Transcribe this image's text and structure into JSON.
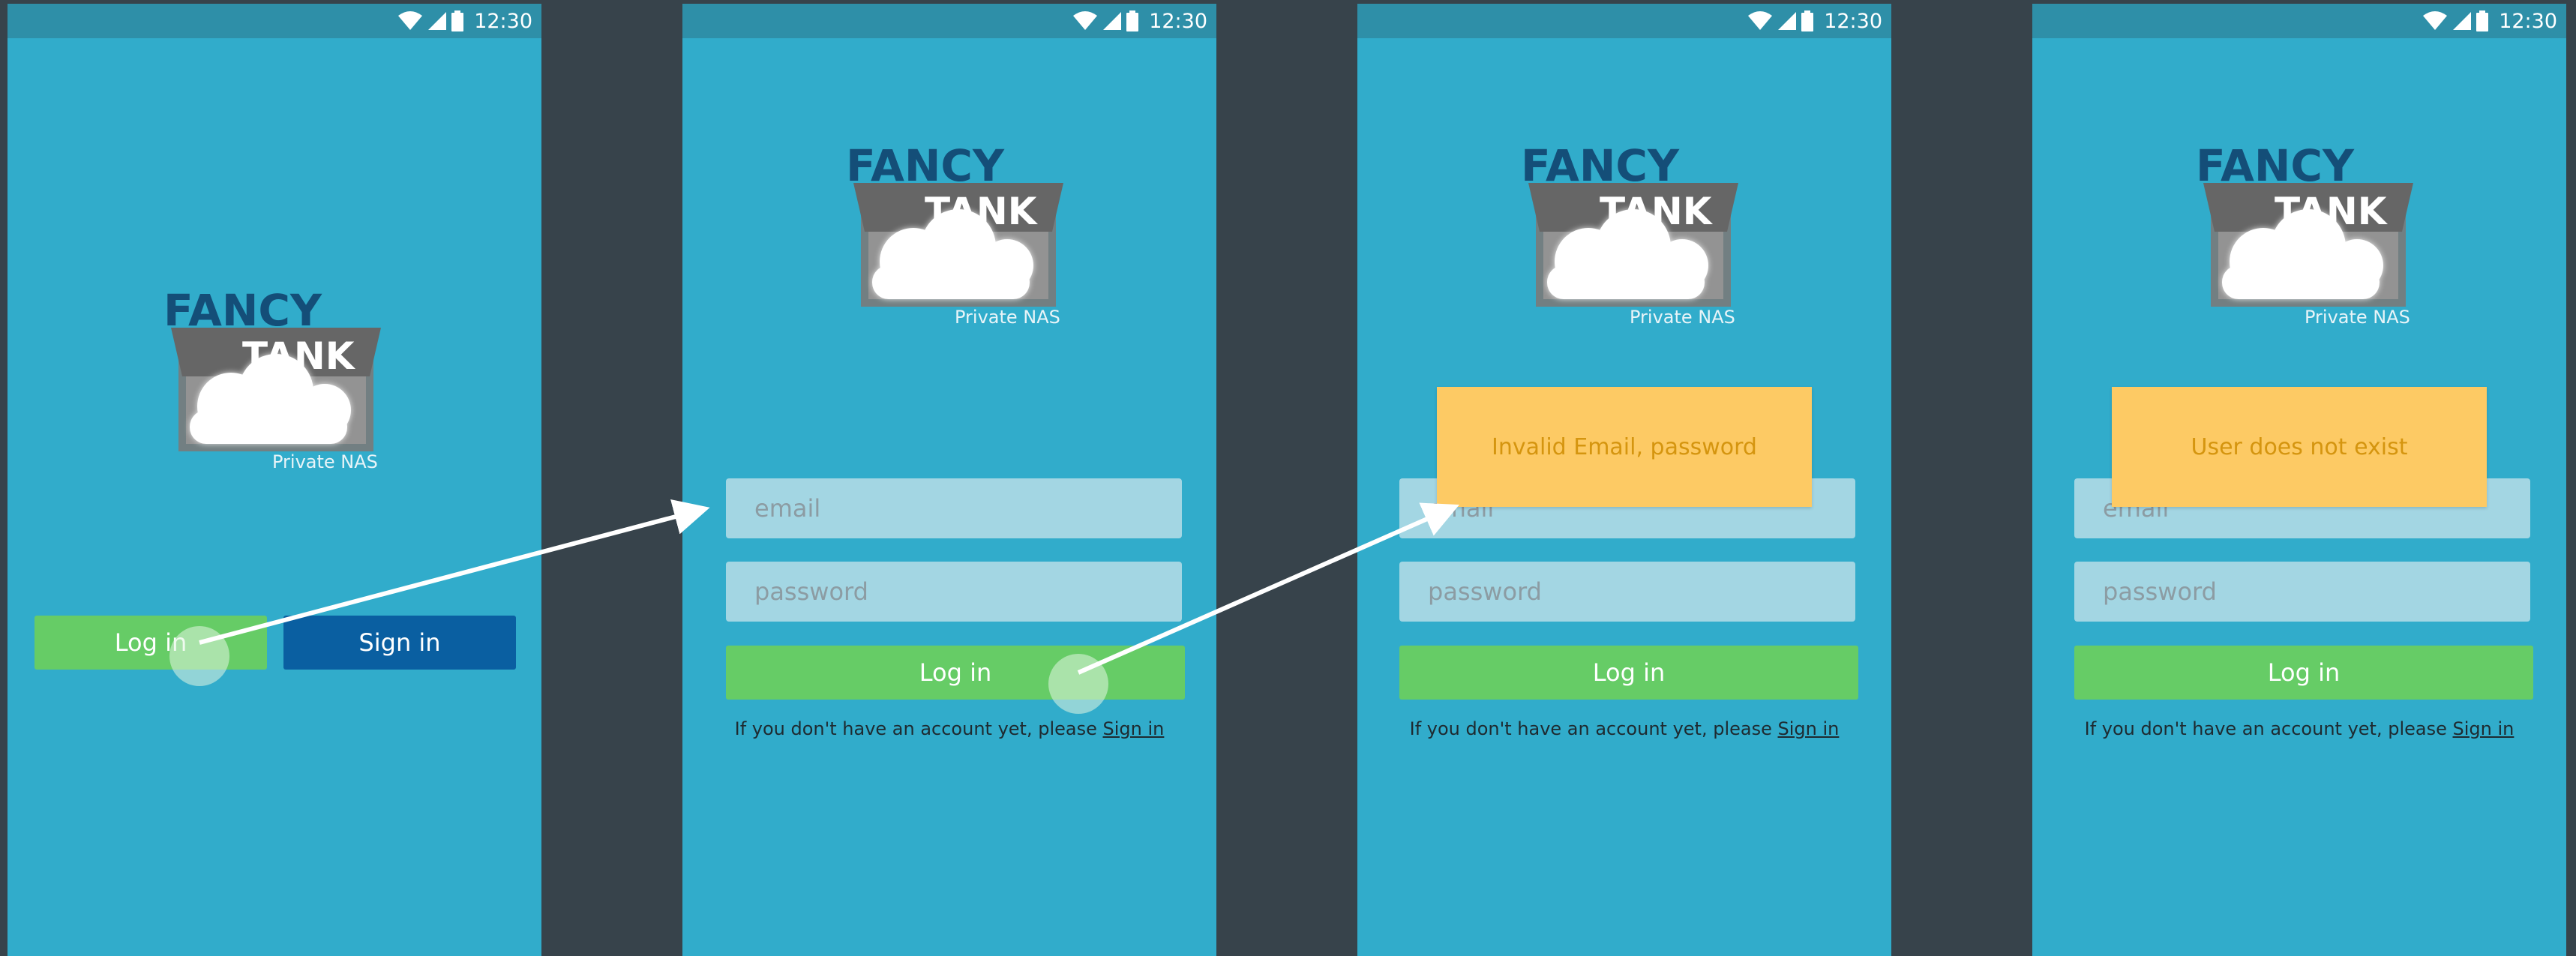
{
  "status_bar": {
    "time": "12:30"
  },
  "logo": {
    "line1": "FANCY",
    "line2": "TANK",
    "tagline": "Private NAS"
  },
  "screen1": {
    "login_label": "Log in",
    "signin_label": "Sign in"
  },
  "form": {
    "email_placeholder": "email",
    "password_placeholder": "password",
    "login_label": "Log in",
    "hint_prefix": "If you don't have an account yet, please",
    "hint_link": "Sign in"
  },
  "screen3": {
    "error_toast": "Invalid Email, password"
  },
  "screen4": {
    "error_toast": "User does not exist"
  },
  "colors": {
    "screen_bg": "#31accb",
    "status_bar": "#2e8fa8",
    "green": "#66cc66",
    "blue": "#0a5fa1",
    "field_bg": "#a3d6e3",
    "toast_bg": "#fdca64",
    "toast_text": "#d5950f",
    "divider": "#37434b"
  }
}
